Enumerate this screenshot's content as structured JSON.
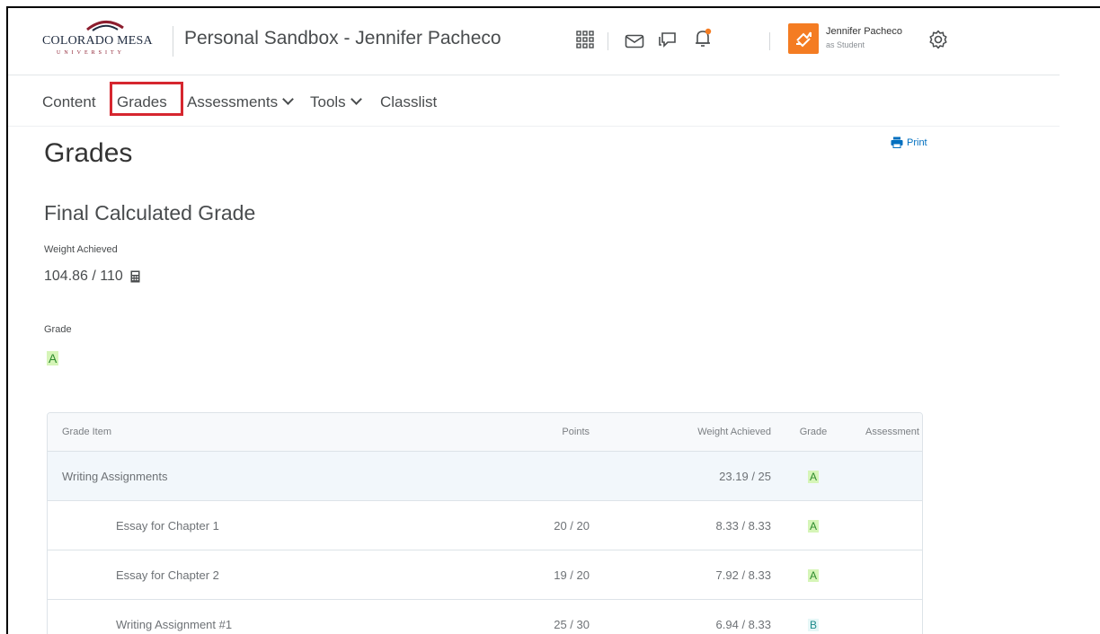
{
  "header": {
    "logo_text": "COLORADO MESA",
    "logo_sub": "UNIVERSITY",
    "course_title": "Personal Sandbox - Jennifer Pacheco",
    "icons": [
      "waffle-grid-icon",
      "envelope-icon",
      "chat-icon",
      "bell-icon",
      "role-switch-icon",
      "gear-icon"
    ],
    "user_name": "Jennifer Pacheco",
    "user_role": "as Student"
  },
  "nav": {
    "items": [
      {
        "label": "Content"
      },
      {
        "label": "Grades"
      },
      {
        "label": "Assessments"
      },
      {
        "label": "Tools"
      },
      {
        "label": "Classlist"
      }
    ]
  },
  "page": {
    "title": "Grades",
    "print_label": "Print",
    "final_title": "Final Calculated Grade",
    "weight_label": "Weight Achieved",
    "weight_value": "104.86 / 110",
    "grade_label": "Grade",
    "grade_value": "A"
  },
  "table": {
    "headers": {
      "item": "Grade Item",
      "points": "Points",
      "weight": "Weight Achieved",
      "grade": "Grade",
      "assessment": "Assessment"
    },
    "rows": [
      {
        "item": "Writing Assignments",
        "points": "",
        "weight": "23.19 / 25",
        "grade": "A"
      },
      {
        "item": "Essay for Chapter 1",
        "points": "20 / 20",
        "weight": "8.33 / 8.33",
        "grade": "A"
      },
      {
        "item": "Essay for Chapter 2",
        "points": "19 / 20",
        "weight": "7.92 / 8.33",
        "grade": "A"
      },
      {
        "item": "Writing Assignment #1",
        "points": "25 / 30",
        "weight": "6.94 / 8.33",
        "grade": "B"
      }
    ]
  },
  "colors": {
    "highlight_border": "#d6262f",
    "link": "#006fbf",
    "avatar": "#f47c22",
    "grade_a_bg": "#d6f5b8"
  }
}
